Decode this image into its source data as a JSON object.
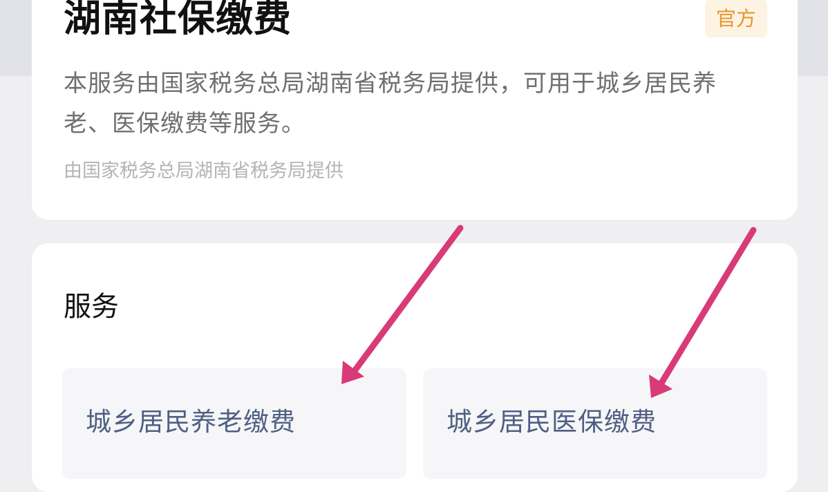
{
  "header": {
    "title": "湖南社保缴费",
    "official_badge": "官方",
    "description": "本服务由国家税务总局湖南省税务局提供，可用于城乡居民养老、医保缴费等服务。",
    "provider": "由国家税务总局湖南省税务局提供"
  },
  "services": {
    "heading": "服务",
    "items": [
      {
        "label": "城乡居民养老缴费"
      },
      {
        "label": "城乡居民医保缴费"
      }
    ]
  },
  "annotations": {
    "arrow_color": "#d93a78"
  },
  "colors": {
    "background": "#efeff2",
    "card": "#ffffff",
    "tile": "#f6f6f8",
    "service_text": "#4f5f84",
    "badge_text": "#e6972e",
    "badge_bg": "#fdf3e3"
  }
}
